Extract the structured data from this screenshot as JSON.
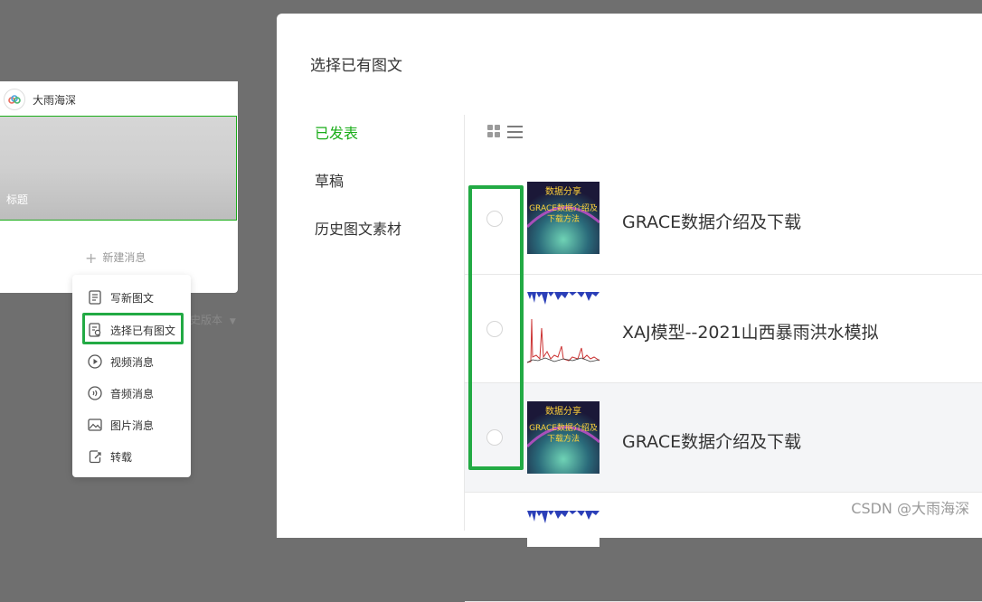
{
  "editor": {
    "account_name": "大雨海深",
    "cover_title": "标题",
    "new_message": "新建消息",
    "history_version": "史版本"
  },
  "menu": {
    "items": [
      {
        "label": "写新图文",
        "icon": "document-icon"
      },
      {
        "label": "选择已有图文",
        "icon": "document-search-icon"
      },
      {
        "label": "视频消息",
        "icon": "play-icon"
      },
      {
        "label": "音频消息",
        "icon": "audio-icon"
      },
      {
        "label": "图片消息",
        "icon": "image-icon"
      },
      {
        "label": "转载",
        "icon": "share-icon"
      }
    ]
  },
  "dialog": {
    "title": "选择已有图文",
    "tabs": [
      {
        "label": "已发表",
        "active": true
      },
      {
        "label": "草稿",
        "active": false
      },
      {
        "label": "历史图文素材",
        "active": false
      }
    ],
    "view_icons": [
      "grid-view-icon",
      "list-view-icon"
    ],
    "articles": [
      {
        "title": "GRACE数据介绍及下载",
        "thumb": "grace-thumbnail",
        "thumb_text": [
          "数据分享",
          "GRACE数据介绍及",
          "下载方法"
        ]
      },
      {
        "title": "XAJ模型--2021山西暴雨洪水模拟",
        "thumb": "hydrograph-thumbnail"
      },
      {
        "title": "GRACE数据介绍及下载",
        "thumb": "grace-thumbnail",
        "thumb_text": [
          "数据分享",
          "GRACE数据介绍及",
          "下载方法"
        ]
      }
    ]
  },
  "watermark": "CSDN @大雨海深",
  "colors": {
    "accent": "#1aad19",
    "highlight": "#22aa44"
  }
}
